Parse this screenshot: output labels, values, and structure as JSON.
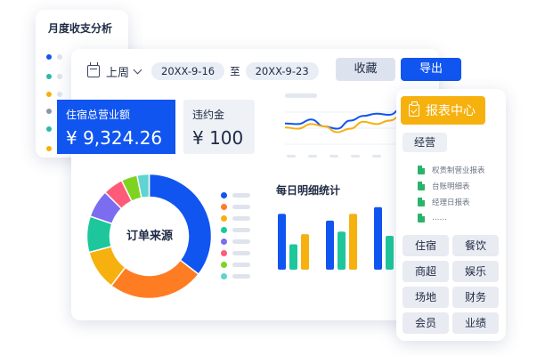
{
  "monthly_card": {
    "title": "月度收支分析",
    "dot_colors": [
      "#1155f0",
      "#2db8a8",
      "#f6b10f",
      "#8c96a8",
      "#2db8a8",
      "#f6b10f"
    ]
  },
  "toolbar": {
    "period": "上周",
    "date_from": "20XX-9-16",
    "to_label": "至",
    "date_to": "20XX-9-23",
    "collect_label": "收藏",
    "export_label": "导出"
  },
  "kpis": {
    "total_revenue_label": "住宿总营业额",
    "total_revenue_value": "¥ 9,324.26",
    "penalty_label": "违约金",
    "penalty_value": "¥ 100"
  },
  "donut": {
    "label": "订单来源",
    "slices": [
      {
        "value": 34,
        "color": "#1155f0"
      },
      {
        "value": 24,
        "color": "#ff7d22"
      },
      {
        "value": 10,
        "color": "#f6b10f"
      },
      {
        "value": 9,
        "color": "#1ec79b"
      },
      {
        "value": 7,
        "color": "#7b6cf0"
      },
      {
        "value": 5,
        "color": "#ff5a7a"
      },
      {
        "value": 4,
        "color": "#7ed321"
      },
      {
        "value": 3,
        "color": "#5fd4d0"
      }
    ],
    "legend_colors": [
      "#1155f0",
      "#ff7d22",
      "#f6b10f",
      "#1ec79b",
      "#7b6cf0",
      "#ff5a7a",
      "#7ed321",
      "#5fd4d0"
    ]
  },
  "daily": {
    "title": "每日明细统计",
    "groups": [
      {
        "values": [
          66,
          30,
          42
        ]
      },
      {
        "values": [
          58,
          45,
          66
        ]
      },
      {
        "values": [
          74,
          40,
          38
        ]
      }
    ],
    "colors": [
      "#1155f0",
      "#1ec79b",
      "#f6b10f"
    ]
  },
  "trend": {
    "series": [
      {
        "color": "#1155f0",
        "values": [
          45,
          44,
          52,
          40,
          36,
          50,
          58,
          62,
          60,
          72
        ]
      },
      {
        "color": "#f6b10f",
        "values": [
          38,
          36,
          44,
          40,
          30,
          36,
          48,
          44,
          50,
          60
        ]
      }
    ]
  },
  "report_center": {
    "title": "报表中心",
    "category": "经营",
    "docs": [
      "权责制营业报表",
      "台账明细表",
      "经理日报表",
      "……"
    ],
    "grid": [
      "住宿",
      "餐饮",
      "商超",
      "娱乐",
      "场地",
      "财务",
      "会员",
      "业绩"
    ]
  },
  "colors": {
    "accent_blue": "#1155f0",
    "accent_yellow": "#f6b10f"
  }
}
